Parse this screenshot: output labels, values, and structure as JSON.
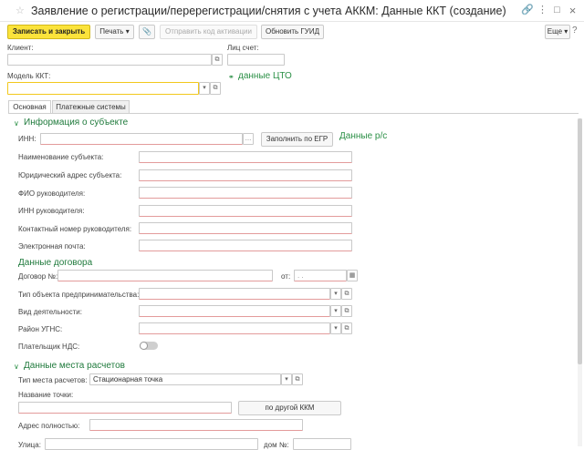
{
  "window": {
    "title": "Заявление о регистрации/перерегистрации/снятия с учета АККМ: Данные ККТ (создание)"
  },
  "toolbar": {
    "save_close": "Записать и закрыть",
    "print": "Печать",
    "send_activation": "Отправить код активации",
    "refresh_guid": "Обновить ГУИД",
    "more": "Еще"
  },
  "header": {
    "client_label": "Клиент:",
    "client_value": "",
    "account_label": "Лиц счет:",
    "account_value": "",
    "model_label": "Модель ККТ:",
    "model_value": "",
    "cto_link": "данные ЦТО"
  },
  "tabs": [
    {
      "label": "Основная"
    },
    {
      "label": "Платежные системы"
    }
  ],
  "subject": {
    "title": "Информация о субъекте",
    "inn_label": "ИНН:",
    "inn_value": "",
    "fill_btn": "Заполнить по ЕГР",
    "rs_link": "Данные р/с",
    "name_label": "Наименование субъекта:",
    "address_label": "Юридический адрес субъекта:",
    "head_label": "ФИО руководителя:",
    "head_inn_label": "ИНН руководителя:",
    "phone_label": "Контактный номер руководителя:",
    "email_label": "Электронная почта:"
  },
  "contract": {
    "title": "Данные договора",
    "number_label": "Договор №:",
    "from_label": "от:",
    "date_placeholder": ". .",
    "biz_type_label": "Тип объекта предпринимательства:",
    "activity_label": "Вид деятельности:",
    "district_label": "Район УГНС:",
    "vat_label": "Плательщик НДС:"
  },
  "place": {
    "title": "Данные места расчетов",
    "type_label": "Тип места расчетов:",
    "type_value": "Стационарная точка",
    "point_name_label": "Название точки:",
    "other_kkm_btn": "по другой ККМ",
    "full_address_label": "Адрес полностью:",
    "street_label": "Улица:",
    "house_label": "дом №:"
  },
  "icons": {
    "link": "link-icon",
    "more_vert": "more-vertical-icon",
    "maximize": "maximize-icon",
    "close": "close-icon",
    "star": "star-icon",
    "paperclip": "paperclip-icon",
    "help": "help-icon",
    "calendar": "calendar-icon"
  }
}
